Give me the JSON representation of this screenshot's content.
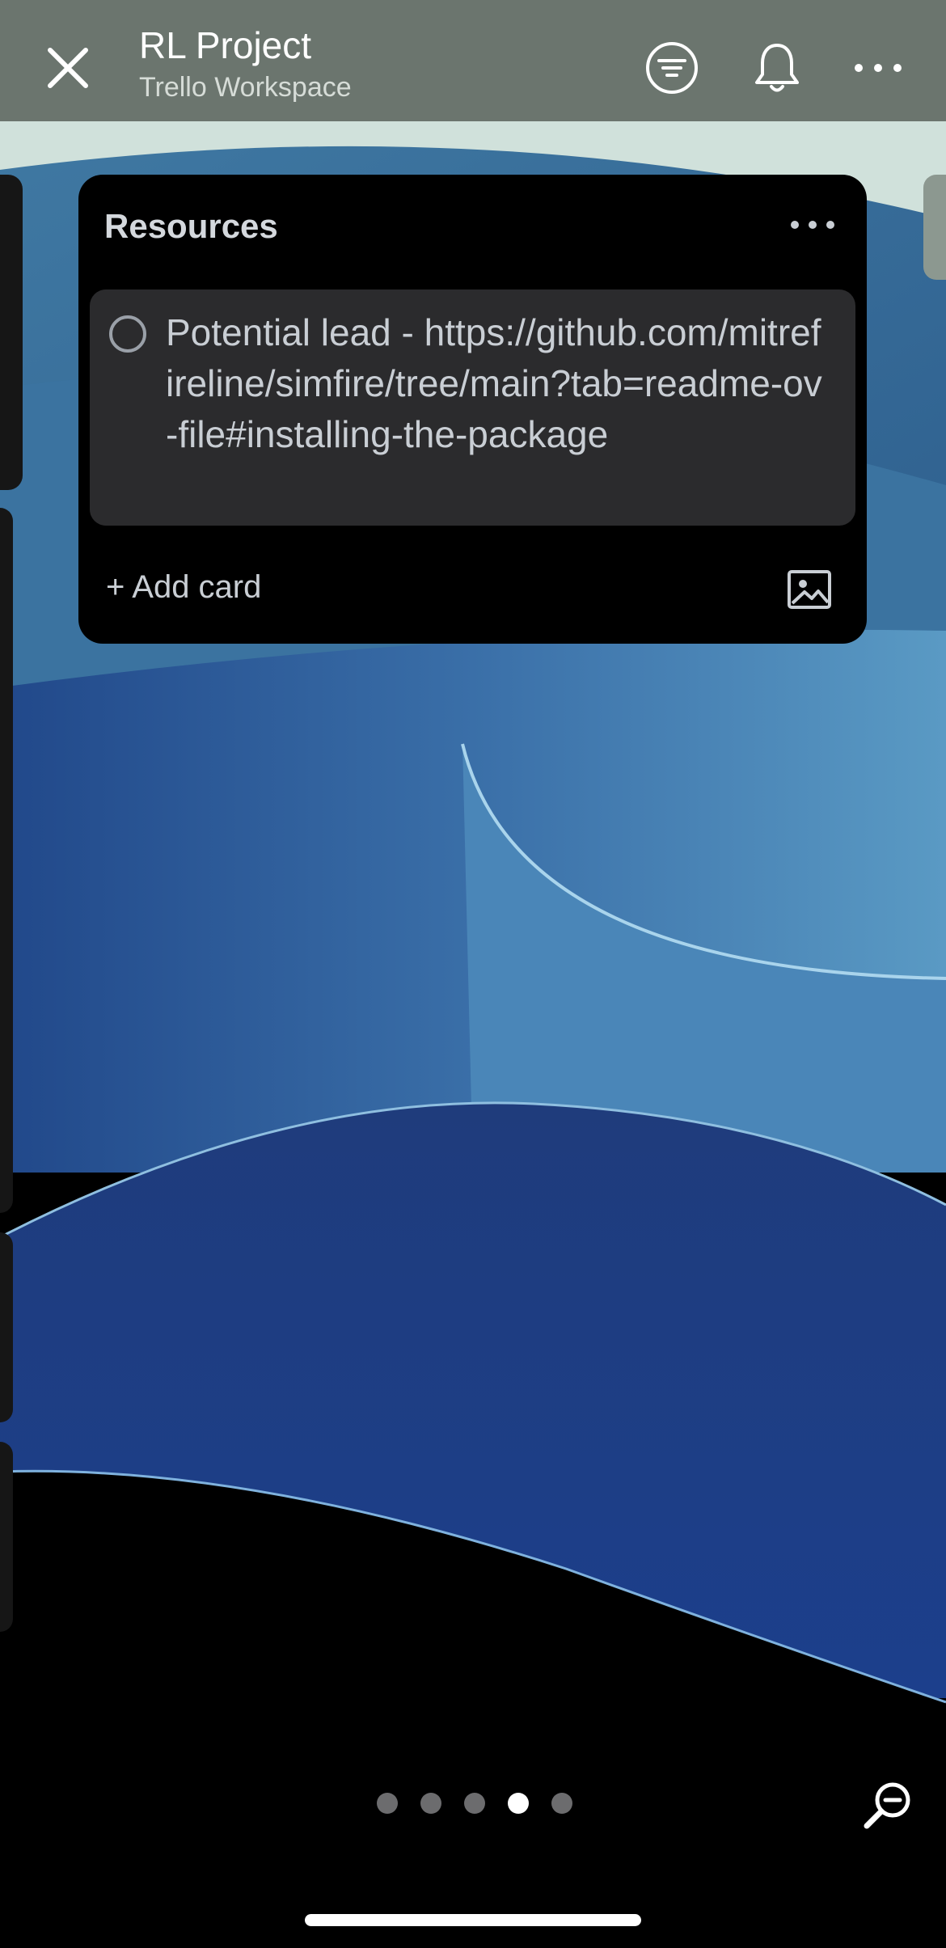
{
  "header": {
    "title": "RL Project",
    "subtitle": "Trello Workspace",
    "icons": [
      "close-icon",
      "filter-icon",
      "bell-icon",
      "more-icon"
    ],
    "background": "#6b756e"
  },
  "list": {
    "title": "Resources",
    "cards": [
      {
        "text": "Potential lead - https://github.com/mitrefireline/simfire/tree/main?tab=readme-ov-file#installing-the-package"
      }
    ],
    "add_card_label": "+ Add card"
  },
  "pager": {
    "count": 5,
    "active_index": 3
  },
  "colors": {
    "list_bg": "#000000",
    "card_bg": "#2b2b2d",
    "text": "#c9ced4"
  }
}
